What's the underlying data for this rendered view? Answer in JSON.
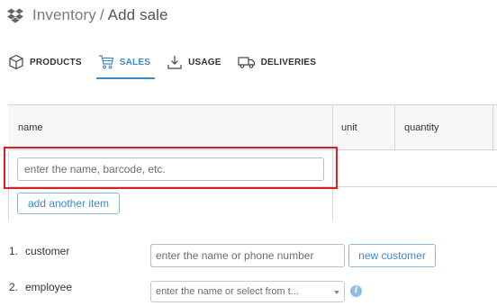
{
  "header": {
    "section": "Inventory",
    "separator": "/",
    "page": "Add sale",
    "icon": "dropbox-icon"
  },
  "tabs": [
    {
      "label": "PRODUCTS",
      "icon": "box-icon",
      "active": false
    },
    {
      "label": "SALES",
      "icon": "cart-icon",
      "active": true
    },
    {
      "label": "USAGE",
      "icon": "download-icon",
      "active": false
    },
    {
      "label": "DELIVERIES",
      "icon": "truck-icon",
      "active": false
    }
  ],
  "table": {
    "columns": [
      "name",
      "unit",
      "quantity"
    ],
    "item_placeholder": "enter the name, barcode, etc.",
    "add_item_label": "add another item"
  },
  "form": {
    "customer": {
      "number": "1.",
      "label": "customer",
      "placeholder": "enter the name or phone number",
      "new_button": "new customer"
    },
    "employee": {
      "number": "2.",
      "label": "employee",
      "placeholder": "enter the name or select from t..."
    }
  },
  "colors": {
    "accent": "#3d8bc9",
    "highlight": "#d71f26"
  }
}
